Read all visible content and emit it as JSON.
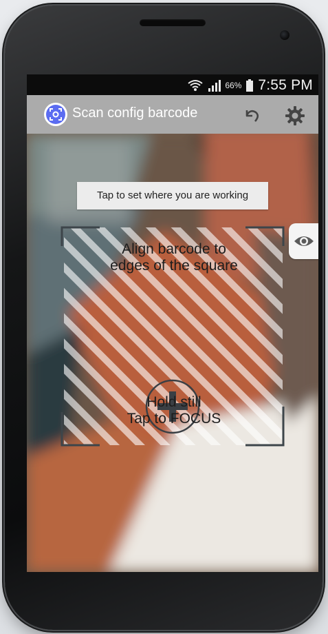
{
  "status_bar": {
    "battery_percent": "66%",
    "time": "7:55 PM"
  },
  "app_bar": {
    "title": "Scan config barcode",
    "app_icon": "barcode-scan-icon",
    "undo_icon": "undo-icon",
    "settings_icon": "gear-icon"
  },
  "scanner": {
    "tooltip": "Tap to set where you are working",
    "align_line1": "Align barcode to",
    "align_line2": "edges of the square",
    "hold_line1": "Hold still",
    "hold_line2": "Tap to FOCUS",
    "eye_icon": "eye-icon",
    "focus_icon": "plus-icon"
  },
  "colors": {
    "app_bar_bg": "#ababab",
    "status_bar_bg": "#0c0c0c",
    "app_icon_accent": "#5b6cf1"
  }
}
